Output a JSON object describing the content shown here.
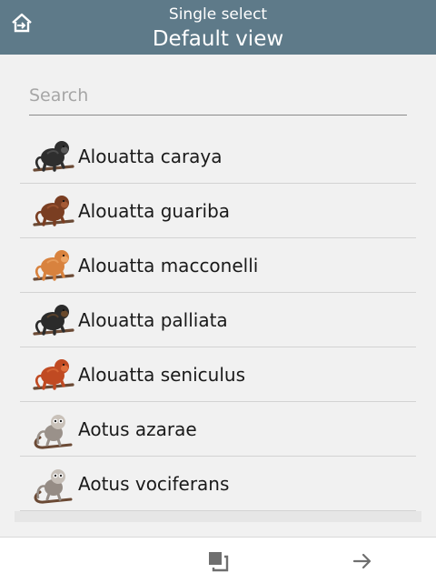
{
  "header": {
    "subtitle": "Single select",
    "title": "Default view",
    "home_icon": "home-icon"
  },
  "search": {
    "placeholder": "Search",
    "value": ""
  },
  "species": [
    {
      "name": "Alouatta caraya",
      "color": "#2e2e2e",
      "accent": "#5a5a5a",
      "icon": "howler-monkey-icon"
    },
    {
      "name": "Alouatta guariba",
      "color": "#7a3e22",
      "accent": "#a55a35",
      "icon": "howler-monkey-icon"
    },
    {
      "name": "Alouatta macconelli",
      "color": "#d8823e",
      "accent": "#eda565",
      "icon": "howler-monkey-icon"
    },
    {
      "name": "Alouatta palliata",
      "color": "#2b2b2b",
      "accent": "#6b4a2c",
      "icon": "howler-monkey-icon"
    },
    {
      "name": "Alouatta seniculus",
      "color": "#c04a22",
      "accent": "#e0703d",
      "icon": "howler-monkey-icon"
    },
    {
      "name": "Aotus azarae",
      "color": "#9a918a",
      "accent": "#c9c1b9",
      "icon": "night-monkey-icon"
    },
    {
      "name": "Aotus vociferans",
      "color": "#958c85",
      "accent": "#c6bfb8",
      "icon": "night-monkey-icon"
    }
  ],
  "footer": {
    "copy_icon": "copy-icon",
    "next_icon": "arrow-right-icon"
  },
  "colors": {
    "header_bg": "#5e7a89",
    "page_bg": "#f1f1f1",
    "branch": "#6b4a35"
  }
}
